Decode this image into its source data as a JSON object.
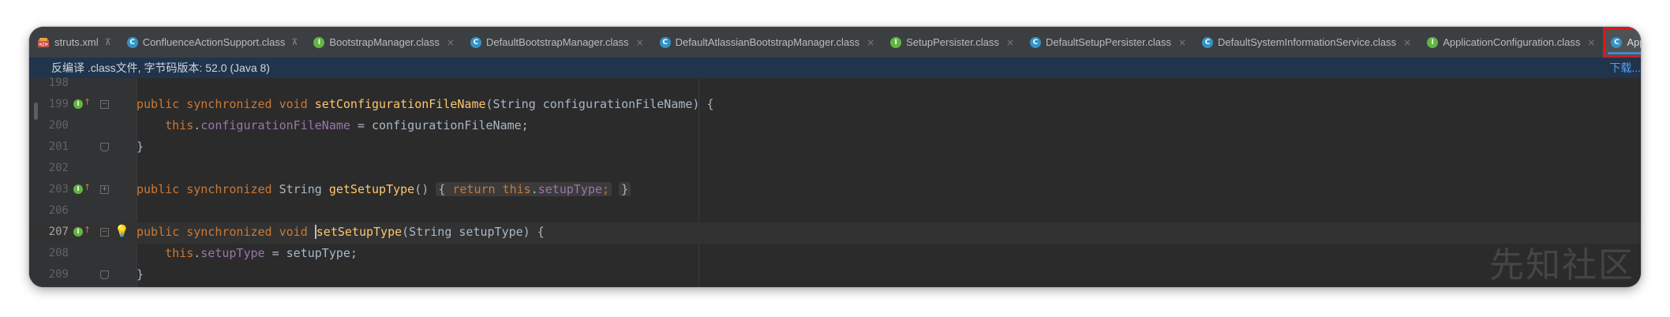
{
  "tabs": [
    {
      "label": "struts.xml",
      "icon": "xml-file-icon",
      "pinned": true
    },
    {
      "label": "ConfluenceActionSupport.class",
      "icon": "class-icon",
      "pinned": true
    },
    {
      "label": "BootstrapManager.class",
      "icon": "interface-icon",
      "close": "×"
    },
    {
      "label": "DefaultBootstrapManager.class",
      "icon": "class-icon",
      "close": "×"
    },
    {
      "label": "DefaultAtlassianBootstrapManager.class",
      "icon": "class-icon",
      "close": "×"
    },
    {
      "label": "SetupPersister.class",
      "icon": "interface-icon",
      "close": "×"
    },
    {
      "label": "DefaultSetupPersister.class",
      "icon": "class-icon",
      "close": "×"
    },
    {
      "label": "DefaultSystemInformationService.class",
      "icon": "class-icon",
      "close": "×"
    },
    {
      "label": "ApplicationConfiguration.class",
      "icon": "interface-icon",
      "close": "×"
    },
    {
      "label": "ApplicationConfig.class",
      "icon": "class-icon",
      "close": "×",
      "active": true
    }
  ],
  "icon_letters": {
    "class": "C",
    "interface": "I"
  },
  "banner": {
    "text": "反编译 .class文件, 字节码版本: 52.0 (Java 8)",
    "link": "下载..."
  },
  "editor": {
    "lines": [
      {
        "num": "198",
        "code": ""
      },
      {
        "num": "199",
        "code": "public synchronized void setConfigurationFileName(String configurationFileName) {"
      },
      {
        "num": "200",
        "code": "this.configurationFileName = configurationFileName;"
      },
      {
        "num": "201",
        "code": "}"
      },
      {
        "num": "202",
        "code": ""
      },
      {
        "num": "203",
        "code": "public synchronized String getSetupType() { return this.setupType; }"
      },
      {
        "num": "206",
        "code": ""
      },
      {
        "num": "207",
        "code": "public synchronized void setSetupType(String setupType) {",
        "current": true
      },
      {
        "num": "208",
        "code": "this.setupType = setupType;"
      },
      {
        "num": "209",
        "code": "}"
      }
    ]
  },
  "tokens": {
    "public": "public",
    "synchronized": "synchronized",
    "void": "void",
    "return": "return",
    "this": "this",
    "setConfigurationFileName": "setConfigurationFileName",
    "paramA": "(String configurationFileName) {",
    "configurationFileName": "configurationFileName",
    "assignA": " = configurationFileName;",
    "String": "String",
    "getSetupType": "getSetupType",
    "getParens": "() ",
    "lbrace": "{",
    "rbrace": "}",
    "setupType": "setupType",
    "semi": ";",
    "setSetupType": "setSetupType",
    "paramB": "(String setupType) {",
    "assignB": " = setupType;",
    "dot": ".",
    "space": " "
  },
  "gutter": {
    "implements_icon_letter": "I",
    "arrow": "↑"
  },
  "watermark": "先知社区",
  "colors": {
    "keyword": "#cc7832",
    "method": "#ffc66d",
    "field": "#9876aa",
    "text": "#a9b7c6",
    "class_icon": "#3592c4",
    "interface_icon": "#62b543",
    "active_tab_highlight": "#e0151d"
  }
}
